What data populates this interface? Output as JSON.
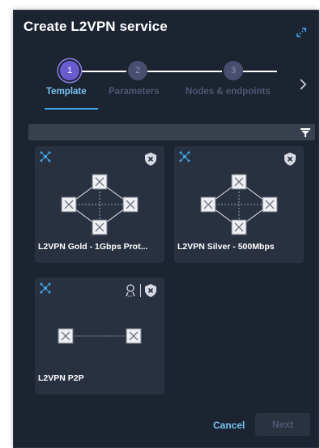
{
  "dialog": {
    "title": "Create L2VPN service"
  },
  "stepper": {
    "steps": [
      {
        "number": "1",
        "label": "Template",
        "state": "active"
      },
      {
        "number": "2",
        "label": "Parameters",
        "state": "inactive"
      },
      {
        "number": "3",
        "label": "Nodes & endpoints",
        "state": "inactive"
      }
    ]
  },
  "search": {
    "value": "",
    "placeholder": ""
  },
  "templates": [
    {
      "label": "L2VPN Gold - 1Gbps Prot...",
      "topology": "ring"
    },
    {
      "label": "L2VPN Silver - 500Mbps",
      "topology": "ring"
    },
    {
      "label": "L2VPN P2P",
      "topology": "p2p"
    }
  ],
  "footer": {
    "cancel_label": "Cancel",
    "next_label": "Next"
  },
  "colors": {
    "background": "#1c2331",
    "card": "#293141",
    "accent": "#3ea6ea",
    "step_active": "#6a5bd0"
  },
  "icons": {
    "expand": "expand-icon",
    "next": "chevron-right-icon",
    "filter": "filter-icon",
    "network": "network-icon",
    "shield": "shield-x-icon",
    "node": "node-icon"
  }
}
